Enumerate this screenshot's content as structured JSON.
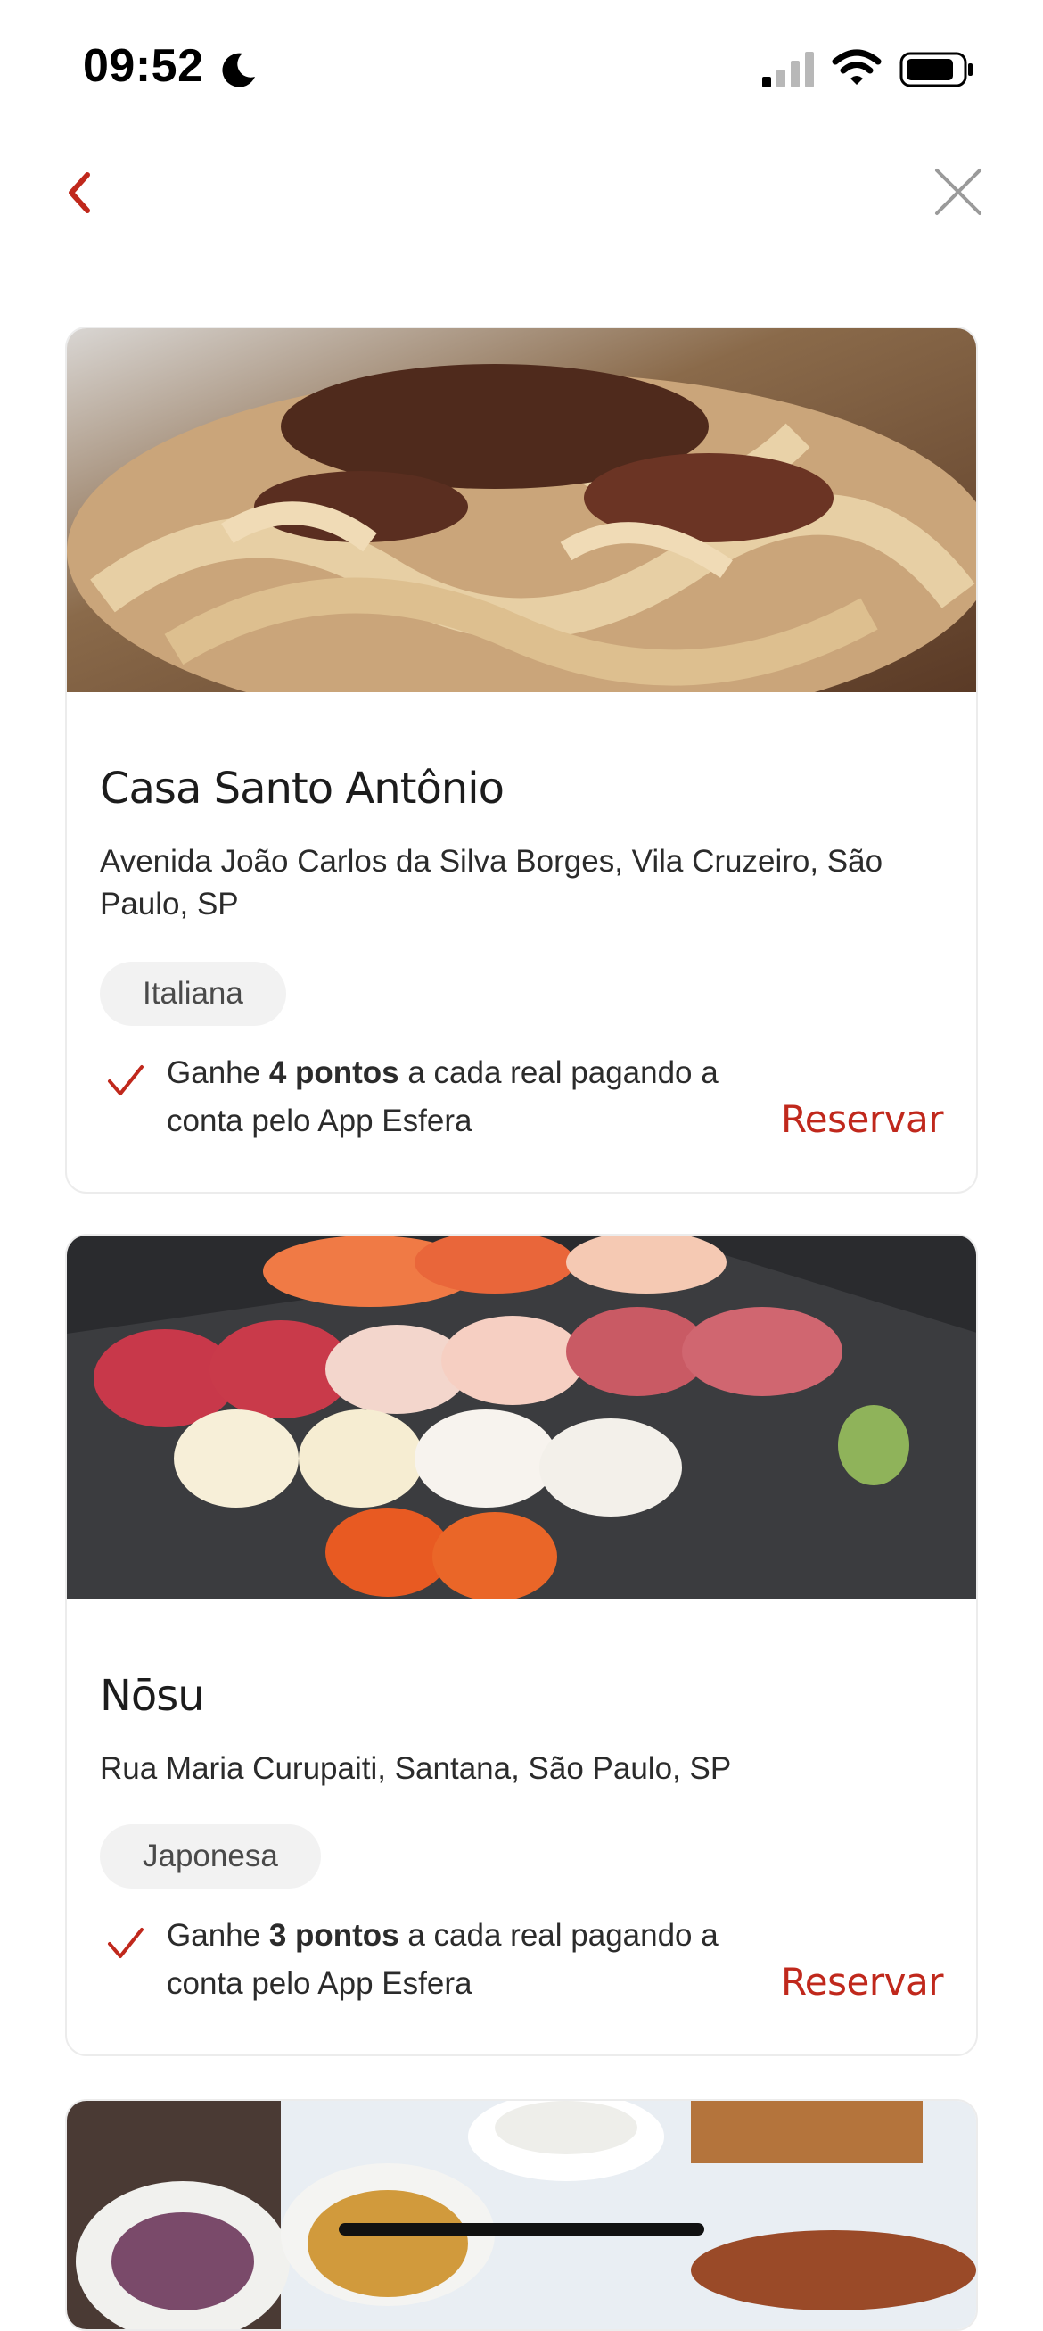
{
  "status_bar": {
    "time": "09:52",
    "icons": [
      "moon-icon",
      "signal-icon",
      "wifi-icon",
      "battery-icon"
    ]
  },
  "nav": {
    "back_icon": "chevron-left-icon",
    "close_icon": "close-icon"
  },
  "colors": {
    "accent": "#c0281c",
    "tag_bg": "#f2f2f2",
    "card_border": "#ececec"
  },
  "restaurants": [
    {
      "name": "Casa Santo Antônio",
      "address": "Avenida João Carlos da Silva Borges, Vila Cruzeiro, São Paulo, SP",
      "cuisine": "Italiana",
      "points_prefix": "Ganhe ",
      "points_value": "4 pontos",
      "points_suffix": " a cada real pagando a conta pelo App Esfera",
      "action": "Reservar",
      "image": "pasta-photo"
    },
    {
      "name": "Nōsu",
      "address": "Rua Maria Curupaiti, Santana, São Paulo, SP",
      "cuisine": "Japonesa",
      "points_prefix": "Ganhe ",
      "points_value": "3 pontos",
      "points_suffix": " a cada real pagando a conta pelo App Esfera",
      "action": "Reservar",
      "image": "sushi-photo"
    },
    {
      "image": "food-platter-photo"
    }
  ]
}
